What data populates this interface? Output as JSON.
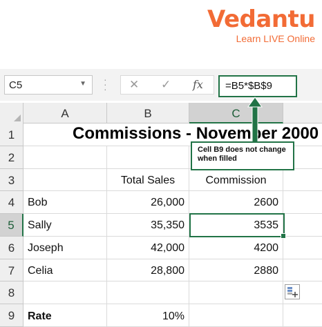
{
  "logo": {
    "brand": "Vedantu",
    "tagline": "Learn LIVE Online"
  },
  "formula_bar": {
    "name_box": "C5",
    "cancel_symbol": "✕",
    "enter_symbol": "✓",
    "fx_symbol": "fx",
    "formula": "=B5*$B$9"
  },
  "columns": [
    "A",
    "B",
    "C"
  ],
  "rows": [
    "1",
    "2",
    "3",
    "4",
    "5",
    "6",
    "7",
    "8",
    "9"
  ],
  "sheet": {
    "title": "Commissions - November 2000",
    "header_total_sales": "Total Sales",
    "header_commission": "Commission",
    "data": [
      {
        "name": "Bob",
        "sales": "26,000",
        "commission": "2600"
      },
      {
        "name": "Sally",
        "sales": "35,350",
        "commission": "3535"
      },
      {
        "name": "Joseph",
        "sales": "42,000",
        "commission": "4200"
      },
      {
        "name": "Celia",
        "sales": "28,800",
        "commission": "2880"
      }
    ],
    "rate_label": "Rate",
    "rate_value": "10%"
  },
  "callout": {
    "text": "Cell B9 does not change when filled"
  },
  "colors": {
    "accent": "#217346",
    "brand": "#f26b35"
  }
}
